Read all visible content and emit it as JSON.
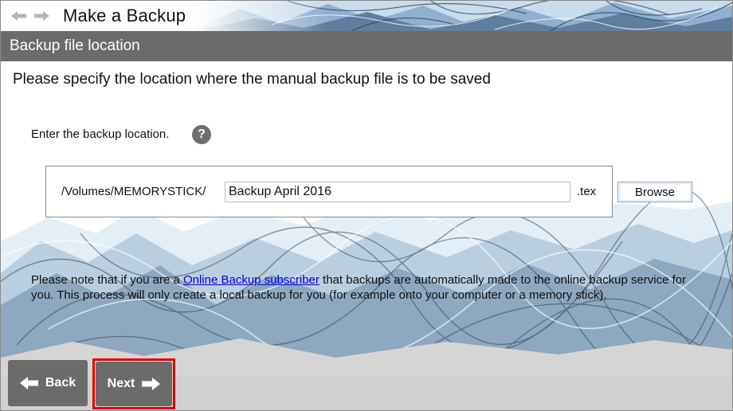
{
  "window": {
    "title": "Make a Backup"
  },
  "nav": {
    "back_icon": "left-arrow-icon",
    "forward_icon": "right-arrow-icon"
  },
  "section": {
    "header": "Backup file location",
    "instruction": "Please specify the location where the manual backup file is to be saved"
  },
  "location": {
    "label": "Enter the backup location.",
    "help_icon": "help-icon",
    "help_glyph": "?",
    "path_prefix": "/Volumes/MEMORYSTICK/",
    "filename_value": "Backup April 2016",
    "extension": ".tex",
    "browse_label": "Browse"
  },
  "note": {
    "before_link": "Please note that if you are a ",
    "link_text": "Online Backup subscriber",
    "after_link": " that backups are automatically made to the online backup service for you. This process will only create a local backup for you (for example onto your computer or a memory stick)."
  },
  "buttons": {
    "back_label": "Back",
    "next_label": "Next"
  },
  "colors": {
    "header_bg": "#6b6b6b",
    "button_bg": "#6b6b6b",
    "highlight": "#e00000",
    "link": "#0000ee"
  }
}
